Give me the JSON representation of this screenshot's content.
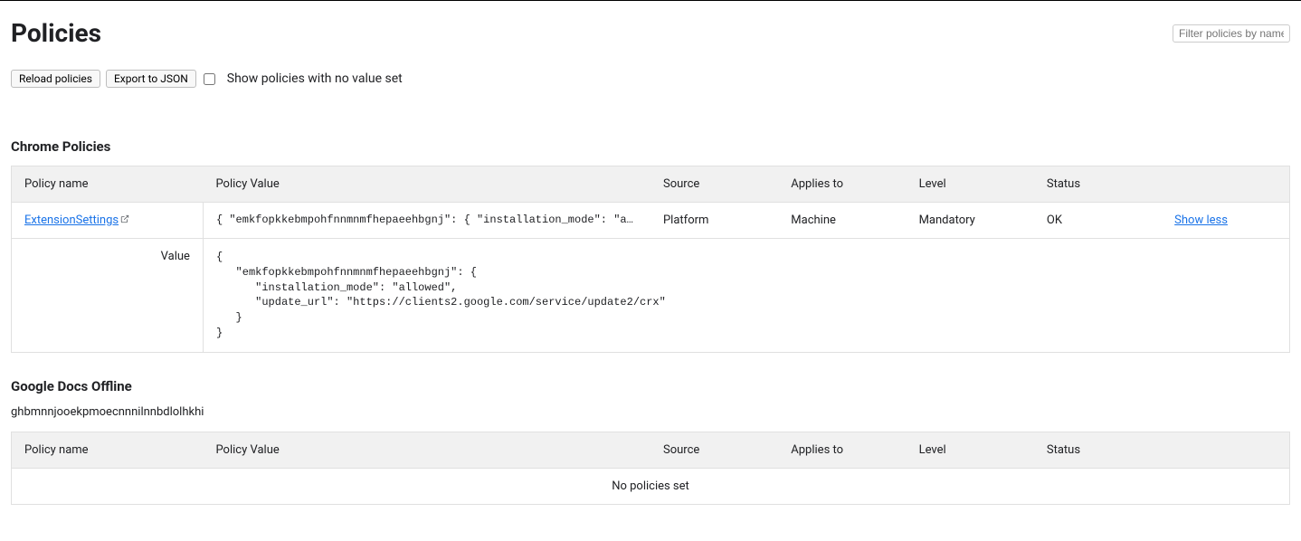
{
  "page_title": "Policies",
  "filter_placeholder": "Filter policies by name",
  "toolbar": {
    "reload_label": "Reload policies",
    "export_label": "Export to JSON",
    "show_unset_label": "Show policies with no value set"
  },
  "columns": {
    "name": "Policy name",
    "value": "Policy Value",
    "source": "Source",
    "applies": "Applies to",
    "level": "Level",
    "status": "Status"
  },
  "sections": [
    {
      "title": "Chrome Policies",
      "rows": [
        {
          "name": "ExtensionSettings",
          "short_value": "{ \"emkfopkkebmpohfnnmnmfhepaeehbgnj\": { \"installation_mode\": \"allowed\", \"…",
          "source": "Platform",
          "applies": "Machine",
          "level": "Mandatory",
          "status": "OK",
          "action": "Show less",
          "expanded_label": "Value",
          "expanded_value": "{\n   \"emkfopkkebmpohfnnmnmfhepaeehbgnj\": {\n      \"installation_mode\": \"allowed\",\n      \"update_url\": \"https://clients2.google.com/service/update2/crx\"\n   }\n}"
        }
      ]
    },
    {
      "title": "Google Docs Offline",
      "subtitle": "ghbmnnjooekpmoecnnnilnnbdlolhkhi",
      "empty": "No policies set"
    }
  ]
}
